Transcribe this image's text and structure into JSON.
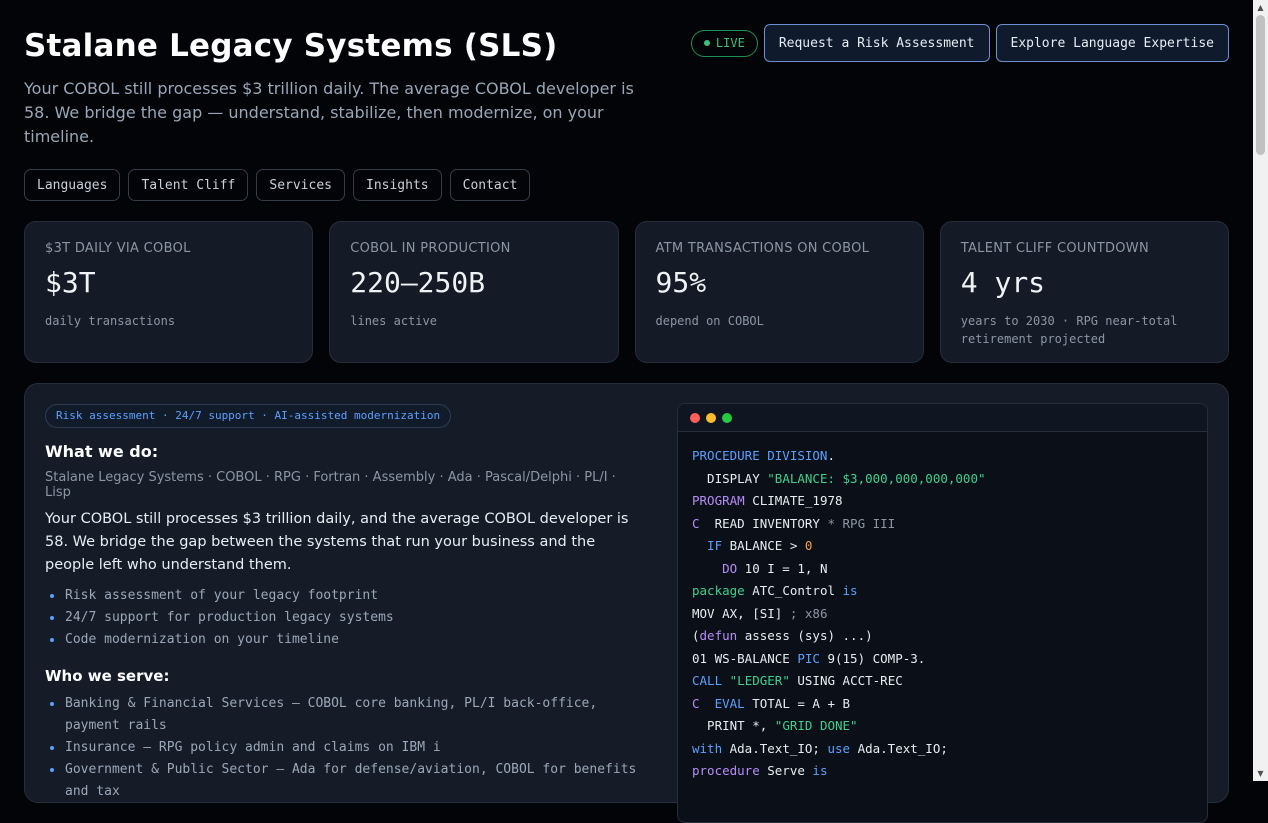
{
  "header": {
    "title": "Stalane Legacy Systems (SLS)",
    "subtitle": "Your COBOL still processes $3 trillion daily. The average COBOL developer is 58. We bridge the gap — understand, stabilize, then modernize, on your timeline.",
    "live_label": "LIVE",
    "cta_primary": "Request a Risk Assessment",
    "cta_secondary": "Explore Language Expertise"
  },
  "nav": [
    "Languages",
    "Talent Cliff",
    "Services",
    "Insights",
    "Contact"
  ],
  "stats": [
    {
      "label": "$3T DAILY VIA COBOL",
      "value": "$3T",
      "note": "daily transactions"
    },
    {
      "label": "COBOL IN PRODUCTION",
      "value": "220–250B",
      "note": "lines active"
    },
    {
      "label": "ATM TRANSACTIONS ON COBOL",
      "value": "95%",
      "note": "depend on COBOL"
    },
    {
      "label": "TALENT CLIFF COUNTDOWN",
      "value": "4 yrs",
      "note": "years to 2030 · RPG near-total retirement projected"
    }
  ],
  "main": {
    "chip": "Risk assessment · 24/7 support · AI-assisted modernization",
    "what_heading": "What we do:",
    "languages": "Stalane Legacy Systems · COBOL · RPG · Fortran · Assembly · Ada · Pascal/Delphi · PL/I · Lisp",
    "body": "Your COBOL still processes $3 trillion daily, and the average COBOL developer is 58. We bridge the gap between the systems that run your business and the people left who understand them.",
    "what_bullets": [
      "Risk assessment of your legacy footprint",
      "24/7 support for production legacy systems",
      "Code modernization on your timeline"
    ],
    "who_heading": "Who we serve:",
    "who_bullets": [
      "Banking & Financial Services — COBOL core banking, PL/I back-office, payment rails",
      "Insurance — RPG policy admin and claims on IBM i",
      "Government & Public Sector — Ada for defense/aviation, COBOL for benefits and tax"
    ]
  },
  "code": [
    [
      {
        "t": "PROCEDURE DIVISION",
        "c": "blue"
      },
      {
        "t": ".",
        "c": "plain"
      }
    ],
    [
      {
        "t": "  DISPLAY ",
        "c": "plain"
      },
      {
        "t": "\"BALANCE: $3,000,000,000,000\"",
        "c": "green"
      }
    ],
    [
      {
        "t": "PROGRAM",
        "c": "purple"
      },
      {
        "t": " CLIMATE_1978",
        "c": "plain"
      }
    ],
    [
      {
        "t": "C",
        "c": "purple"
      },
      {
        "t": "  READ INVENTORY ",
        "c": "plain"
      },
      {
        "t": "* RPG III",
        "c": "grey"
      }
    ],
    [
      {
        "t": "  IF",
        "c": "blue"
      },
      {
        "t": " BALANCE > ",
        "c": "plain"
      },
      {
        "t": "0",
        "c": "orange"
      }
    ],
    [
      {
        "t": "    DO",
        "c": "purple"
      },
      {
        "t": " 10 I = 1, N",
        "c": "plain"
      }
    ],
    [
      {
        "t": "package",
        "c": "green"
      },
      {
        "t": " ATC_Control ",
        "c": "plain"
      },
      {
        "t": "is",
        "c": "blue"
      }
    ],
    [
      {
        "t": "MOV AX, [SI] ",
        "c": "plain"
      },
      {
        "t": "; x86",
        "c": "grey"
      }
    ],
    [
      {
        "t": "(",
        "c": "plain"
      },
      {
        "t": "defun",
        "c": "purple"
      },
      {
        "t": " assess (sys) ...)",
        "c": "plain"
      }
    ],
    [
      {
        "t": "01 WS-BALANCE ",
        "c": "plain"
      },
      {
        "t": "PIC",
        "c": "blue"
      },
      {
        "t": " 9(15) COMP-3.",
        "c": "plain"
      }
    ],
    [
      {
        "t": "CALL",
        "c": "blue"
      },
      {
        "t": " ",
        "c": "plain"
      },
      {
        "t": "\"LEDGER\"",
        "c": "green"
      },
      {
        "t": " USING ACCT-REC",
        "c": "plain"
      }
    ],
    [
      {
        "t": "C",
        "c": "purple"
      },
      {
        "t": "  ",
        "c": "plain"
      },
      {
        "t": "EVAL",
        "c": "blue"
      },
      {
        "t": " TOTAL = A + B",
        "c": "plain"
      }
    ],
    [
      {
        "t": "  PRINT *, ",
        "c": "plain"
      },
      {
        "t": "\"GRID DONE\"",
        "c": "green"
      }
    ],
    [
      {
        "t": "with",
        "c": "blue"
      },
      {
        "t": " Ada.Text_IO; ",
        "c": "plain"
      },
      {
        "t": "use",
        "c": "blue"
      },
      {
        "t": " Ada.Text_IO;",
        "c": "plain"
      }
    ],
    [
      {
        "t": "procedure",
        "c": "purple"
      },
      {
        "t": " Serve ",
        "c": "plain"
      },
      {
        "t": "is",
        "c": "blue"
      }
    ]
  ],
  "colors": {
    "accent": "#5aa0ff",
    "live": "#3fbf7f",
    "background": "#020408",
    "card": "#141b26"
  },
  "icons": {
    "traffic_lights": [
      "#ff5f57",
      "#febc2e",
      "#28c840"
    ]
  }
}
